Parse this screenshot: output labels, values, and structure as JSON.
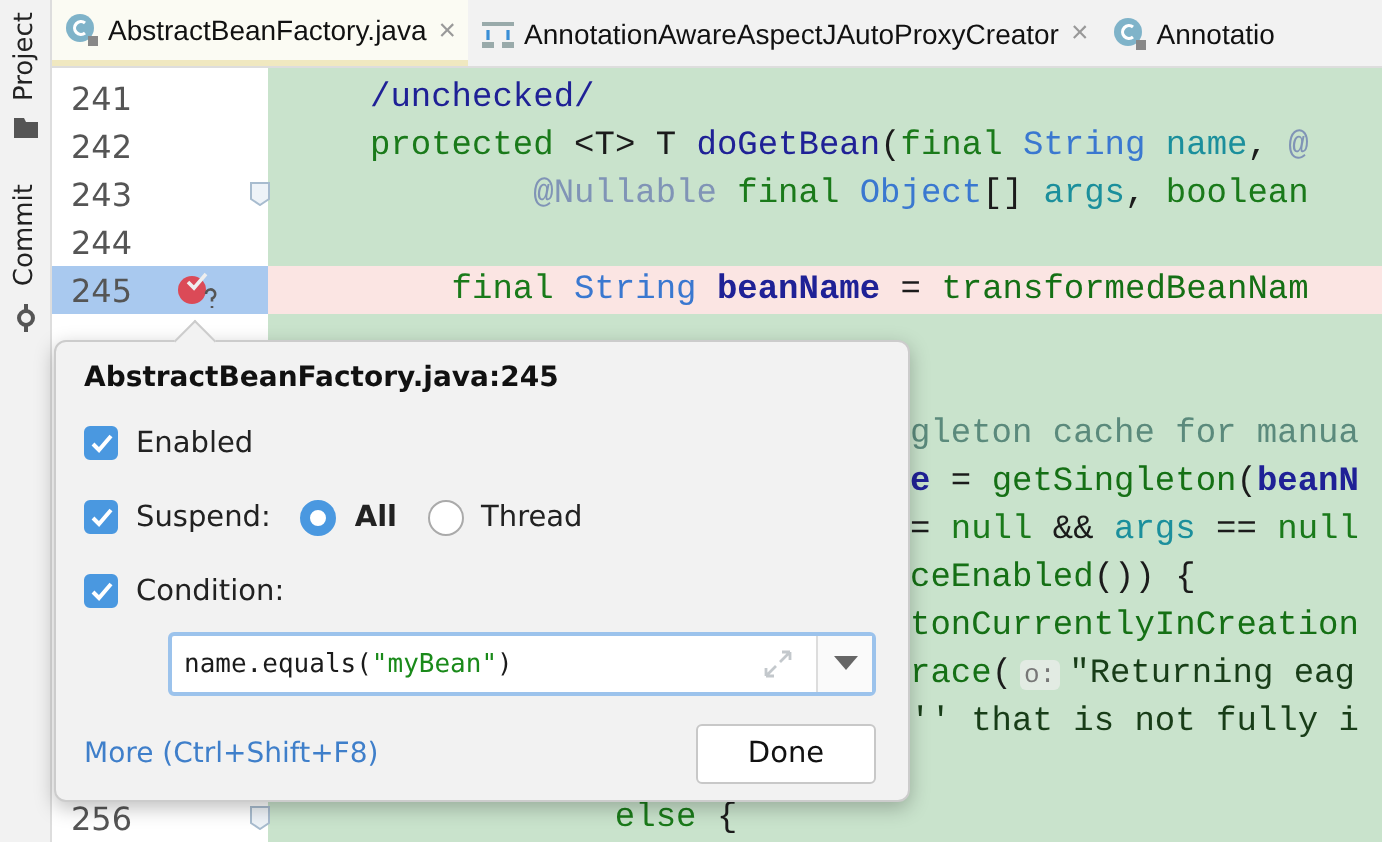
{
  "side_tools": [
    {
      "label": "Project"
    },
    {
      "label": "Commit"
    }
  ],
  "tabs": [
    {
      "label": "AbstractBeanFactory.java",
      "selected": true,
      "close": "×"
    },
    {
      "label": "AnnotationAwareAspectJAutoProxyCreator",
      "selected": false,
      "close": "×"
    },
    {
      "label": "Annotatio",
      "selected": false
    }
  ],
  "lines": [
    {
      "kind": "full",
      "number": "241",
      "tokens": [
        {
          "text": "/unchecked/",
          "kind": "method"
        }
      ]
    },
    {
      "kind": "full",
      "number": "242",
      "tokens": [
        {
          "text": "protected ",
          "kind": "keyword"
        },
        {
          "text": "<",
          "kind": "plain"
        },
        {
          "text": "T",
          "kind": "typevar"
        },
        {
          "text": "> ",
          "kind": "plain"
        },
        {
          "text": "T ",
          "kind": "typevar"
        },
        {
          "text": "doGetBean",
          "kind": "method"
        },
        {
          "text": "(",
          "kind": "plain"
        },
        {
          "text": "final ",
          "kind": "keyword"
        },
        {
          "text": "String ",
          "kind": "type"
        },
        {
          "text": "name",
          "kind": "param"
        },
        {
          "text": ", ",
          "kind": "plain"
        },
        {
          "text": "@",
          "kind": "annotation"
        }
      ]
    },
    {
      "kind": "full",
      "number": "243",
      "fold": true,
      "tokens": [
        {
          "text": "        @Nullable ",
          "kind": "annotation"
        },
        {
          "text": "final ",
          "kind": "keyword"
        },
        {
          "text": "Object",
          "kind": "type"
        },
        {
          "text": "[] ",
          "kind": "plain"
        },
        {
          "text": "args",
          "kind": "param"
        },
        {
          "text": ", ",
          "kind": "plain"
        },
        {
          "text": "boolean",
          "kind": "keyword"
        }
      ]
    },
    {
      "kind": "full",
      "number": "244"
    },
    {
      "kind": "full",
      "number": "245",
      "breakpoint": true,
      "tokens": [
        {
          "text": "    final ",
          "kind": "keyword"
        },
        {
          "text": "String ",
          "kind": "type"
        },
        {
          "text": "beanName",
          "kind": "local"
        },
        {
          "text": " = ",
          "kind": "plain"
        },
        {
          "text": "transformedBeanNam",
          "kind": "call"
        }
      ]
    },
    {
      "kind": "hidden"
    },
    {
      "kind": "hidden"
    },
    {
      "kind": "partial",
      "tokens": [
        {
          "text": "gleton cache for manua",
          "kind": "comment"
        }
      ]
    },
    {
      "kind": "partial",
      "tokens": [
        {
          "text": "e",
          "kind": "local"
        },
        {
          "text": " = ",
          "kind": "plain"
        },
        {
          "text": "getSingleton",
          "kind": "call"
        },
        {
          "text": "(",
          "kind": "plain"
        },
        {
          "text": "beanN",
          "kind": "local"
        }
      ]
    },
    {
      "kind": "partial",
      "tokens": [
        {
          "text": "= ",
          "kind": "plain"
        },
        {
          "text": "null ",
          "kind": "keyword"
        },
        {
          "text": "&& ",
          "kind": "plain"
        },
        {
          "text": "args",
          "kind": "param"
        },
        {
          "text": " == ",
          "kind": "plain"
        },
        {
          "text": "null",
          "kind": "keyword"
        }
      ]
    },
    {
      "kind": "partial",
      "tokens": [
        {
          "text": "ceEnabled",
          "kind": "call"
        },
        {
          "text": "()) {",
          "kind": "plain"
        }
      ]
    },
    {
      "kind": "partial",
      "tokens": [
        {
          "text": "tonCurrentlyInCreation",
          "kind": "call"
        }
      ]
    },
    {
      "kind": "partial",
      "tokens": [
        {
          "text": "race",
          "kind": "call"
        },
        {
          "text": "(",
          "kind": "plain"
        },
        {
          "text": "o:",
          "kind": "hint"
        },
        {
          "text": "\"Returning eag",
          "kind": "string"
        }
      ]
    },
    {
      "kind": "partial",
      "tokens": [
        {
          "text": "'' that is not fully i",
          "kind": "string"
        }
      ]
    },
    {
      "kind": "hidden"
    },
    {
      "kind": "full",
      "number": "256",
      "fold": true,
      "tokens": [
        {
          "text": "            else ",
          "kind": "keyword"
        },
        {
          "text": "{",
          "kind": "plain"
        }
      ]
    }
  ],
  "popup": {
    "title": "AbstractBeanFactory.java:245",
    "enabled": {
      "label": "Enabled",
      "checked": true
    },
    "suspend": {
      "label": "Suspend:",
      "checked": true,
      "options": [
        {
          "label": "All",
          "selected": true
        },
        {
          "label": "Thread",
          "selected": false
        }
      ]
    },
    "condition": {
      "label": "Condition:",
      "checked": true,
      "value": [
        {
          "text": "name.equals(",
          "kind": "plain"
        },
        {
          "text": "\"myBean\"",
          "kind": "string"
        },
        {
          "text": ")",
          "kind": "plain"
        }
      ]
    },
    "more_link": "More (Ctrl+Shift+F8)",
    "done": "Done"
  }
}
